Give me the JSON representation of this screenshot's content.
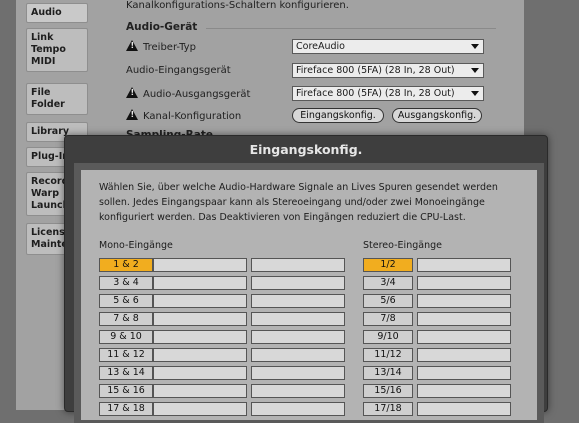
{
  "prefs": {
    "nav": {
      "tabs": [
        {
          "id": "audio",
          "lines": [
            "Audio"
          ]
        },
        {
          "id": "link-tempo-midi",
          "lines": [
            "Link",
            "Tempo",
            "MIDI"
          ]
        },
        {
          "id": "file-folder",
          "lines": [
            "File",
            "Folder"
          ]
        },
        {
          "id": "library",
          "lines": [
            "Library"
          ]
        },
        {
          "id": "plugins",
          "lines": [
            "Plug-In"
          ]
        },
        {
          "id": "record-warp-launch",
          "lines": [
            "Record",
            "Warp",
            "Launch"
          ]
        },
        {
          "id": "license-maintenance",
          "lines": [
            "License",
            "Mainte"
          ]
        }
      ]
    },
    "intro_text": "Kanalkonfigurations-Schaltern konfigurieren.",
    "audio_device": {
      "section_title": "Audio-Gerät",
      "driver_label": "Treiber-Typ",
      "driver_value": "CoreAudio",
      "input_label": "Audio-Eingangsgerät",
      "input_value": "Fireface 800 (5FA) (28 In, 28 Out)",
      "output_label": "Audio-Ausgangsgerät",
      "output_value": "Fireface 800 (5FA) (28 In, 28 Out)",
      "channel_label": "Kanal-Konfiguration",
      "input_config_button": "Eingangskonfig.",
      "output_config_button": "Ausgangskonfig."
    },
    "sampling_title": "Sampling-Rate"
  },
  "dialog": {
    "title": "Eingangskonfig.",
    "description": "Wählen Sie, über welche Audio-Hardware Signale an Lives Spuren gesendet werden sollen. Jedes Eingangspaar kann als Stereoeingang und/oder zwei Monoeingänge konfiguriert werden. Das Deaktivieren von Eingängen reduziert die CPU-Last.",
    "mono_header": "Mono-Eingänge",
    "stereo_header": "Stereo-Eingänge",
    "mono_inputs": [
      {
        "label": "1 & 2",
        "active": true
      },
      {
        "label": "3 & 4",
        "active": false
      },
      {
        "label": "5 & 6",
        "active": false
      },
      {
        "label": "7 & 8",
        "active": false
      },
      {
        "label": "9 & 10",
        "active": false
      },
      {
        "label": "11 & 12",
        "active": false
      },
      {
        "label": "13 & 14",
        "active": false
      },
      {
        "label": "15 & 16",
        "active": false
      },
      {
        "label": "17 & 18",
        "active": false
      }
    ],
    "stereo_inputs": [
      {
        "label": "1/2",
        "active": true
      },
      {
        "label": "3/4",
        "active": false
      },
      {
        "label": "5/6",
        "active": false
      },
      {
        "label": "7/8",
        "active": false
      },
      {
        "label": "9/10",
        "active": false
      },
      {
        "label": "11/12",
        "active": false
      },
      {
        "label": "13/14",
        "active": false
      },
      {
        "label": "15/16",
        "active": false
      },
      {
        "label": "17/18",
        "active": false
      }
    ],
    "active_color": "#f1ad1f"
  }
}
